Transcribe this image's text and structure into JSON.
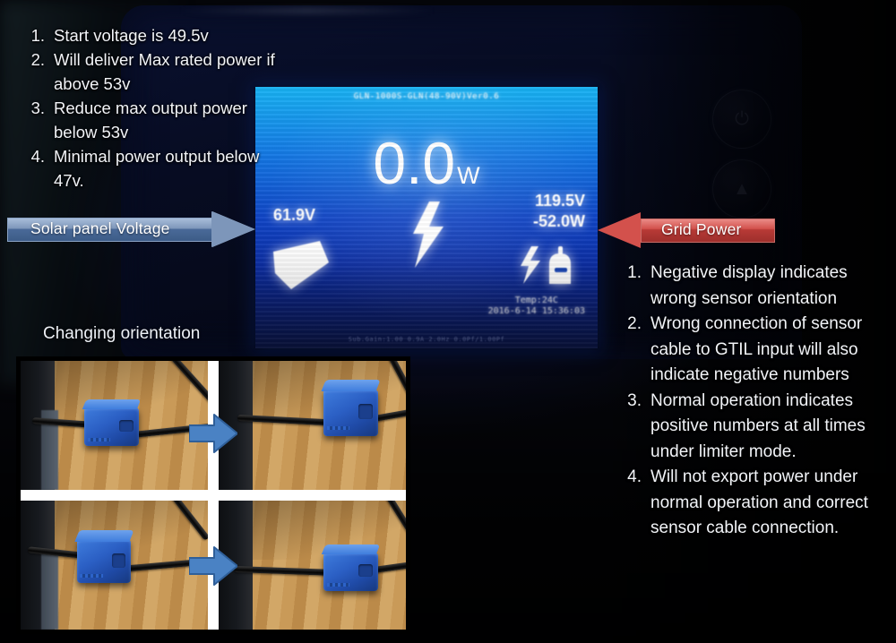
{
  "left_notes": {
    "items": [
      {
        "num": "1.",
        "text": "Start voltage is 49.5v"
      },
      {
        "num": "2.",
        "text": "Will deliver Max rated power if above 53v"
      },
      {
        "num": "3.",
        "text": "Reduce max output power below 53v"
      },
      {
        "num": "4.",
        "text": "Minimal power output below 47v."
      }
    ]
  },
  "right_notes": {
    "items": [
      {
        "num": "1.",
        "text": "Negative display indicates wrong sensor orientation"
      },
      {
        "num": "2.",
        "text": "Wrong connection of sensor cable to GTIL input will also indicate negative numbers"
      },
      {
        "num": "3.",
        "text": "Normal operation indicates positive numbers at all times under limiter mode."
      },
      {
        "num": "4.",
        "text": "Will not export power under normal operation and correct sensor cable connection."
      }
    ]
  },
  "callouts": {
    "solar": {
      "label": "Solar panel Voltage",
      "direction": "right",
      "color": "#6d87ae"
    },
    "grid": {
      "label": "Grid Power",
      "direction": "left",
      "color": "#d3514c"
    }
  },
  "caption": {
    "orientation": "Changing orientation"
  },
  "lcd": {
    "header": "GLN-1000S-GLN(48-90V)Ver0.6",
    "main_power": "0.0",
    "main_power_unit": "W",
    "pv_voltage": "61.9V",
    "grid_voltage": "119.5V",
    "grid_power": "-52.0W",
    "temperature": "Temp:24C",
    "timestamp": "2016-6-14  15:36:03",
    "fine_print": "Sub.Gain:1.00  0.9A    2.0Hz 0.0Pf/1.00Pf",
    "icons": {
      "solar": "solar-panel-icon",
      "bolt": "lightning-bolt-icon",
      "grid": "grid-load-icon"
    }
  },
  "device_buttons": [
    {
      "name": "power-button",
      "glyph": "⏻"
    },
    {
      "name": "select-button",
      "glyph": "▲"
    }
  ],
  "photos": {
    "grid_label": "ct-sensor-orientation-photos",
    "cells": [
      {
        "name": "photo-top-left",
        "caption": ""
      },
      {
        "name": "photo-top-right",
        "caption": ""
      },
      {
        "name": "photo-bottom-left",
        "caption": ""
      },
      {
        "name": "photo-bottom-right",
        "caption": ""
      }
    ],
    "arrows": [
      "arrow-top-right",
      "arrow-bottom-right"
    ]
  }
}
